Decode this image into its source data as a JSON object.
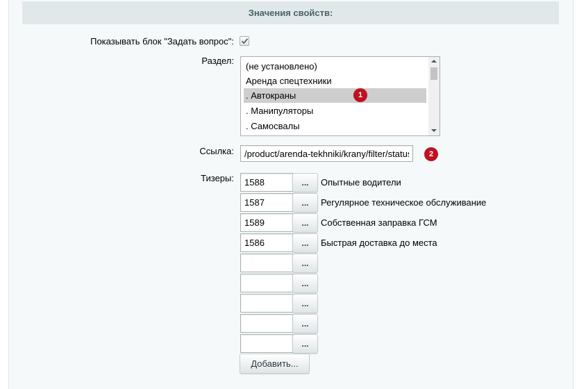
{
  "section": {
    "title": "Значения свойств:"
  },
  "fields": {
    "show_block_label": "Показывать блок \"Задать вопрос\":",
    "show_block_checked": true,
    "section_label": "Раздел:",
    "section_options": [
      "(не установлено)",
      "Аренда спецтехники",
      ". Автокраны",
      ". Манипуляторы",
      ". Самосвалы"
    ],
    "section_selected": ". Автокраны",
    "link_label": "Ссылка:",
    "link_value": "/product/arenda-tekhniki/krany/filter/status",
    "teasers_label": "Тизеры:",
    "teasers": [
      {
        "id": "1588",
        "name": "Опытные водители"
      },
      {
        "id": "1587",
        "name": "Регулярное техническое обслуживание"
      },
      {
        "id": "1589",
        "name": "Собственная заправка ГСМ"
      },
      {
        "id": "1586",
        "name": "Быстрая доставка до места"
      },
      {
        "id": "",
        "name": ""
      },
      {
        "id": "",
        "name": ""
      },
      {
        "id": "",
        "name": ""
      },
      {
        "id": "",
        "name": ""
      },
      {
        "id": "",
        "name": ""
      }
    ],
    "browse_label": "...",
    "add_button_label": "Добавить..."
  },
  "annotations": {
    "badge_1": "1",
    "badge_2": "2"
  },
  "colors": {
    "badge": "#c0111f",
    "header_bg": "#e0e8ea",
    "panel_bg": "#f5f9f9",
    "selected_option": "#cecece"
  }
}
